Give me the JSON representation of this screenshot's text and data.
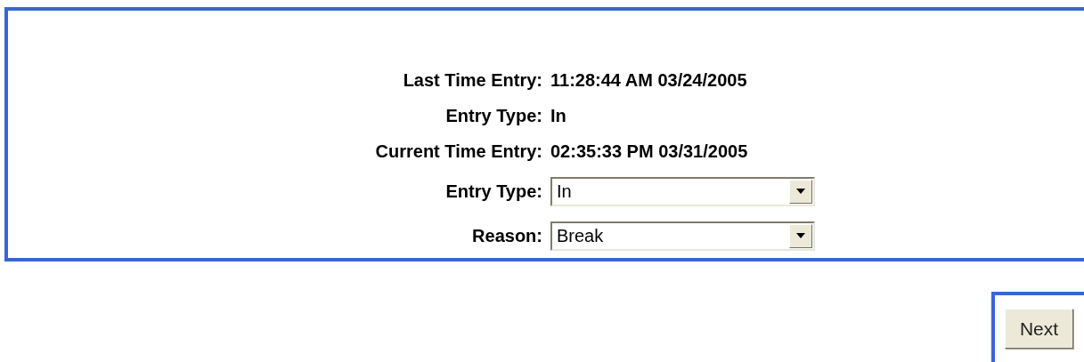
{
  "info_rows": [
    {
      "label": "Last Time Entry:",
      "value": "11:28:44 AM 03/24/2005"
    },
    {
      "label": "Entry Type:",
      "value": "In"
    },
    {
      "label": "Current Time Entry:",
      "value": "02:35:33 PM 03/31/2005"
    }
  ],
  "selects": [
    {
      "label": "Entry Type:",
      "value": "In"
    },
    {
      "label": "Reason:",
      "value": "Break"
    }
  ],
  "next_button": {
    "label": "Next"
  }
}
